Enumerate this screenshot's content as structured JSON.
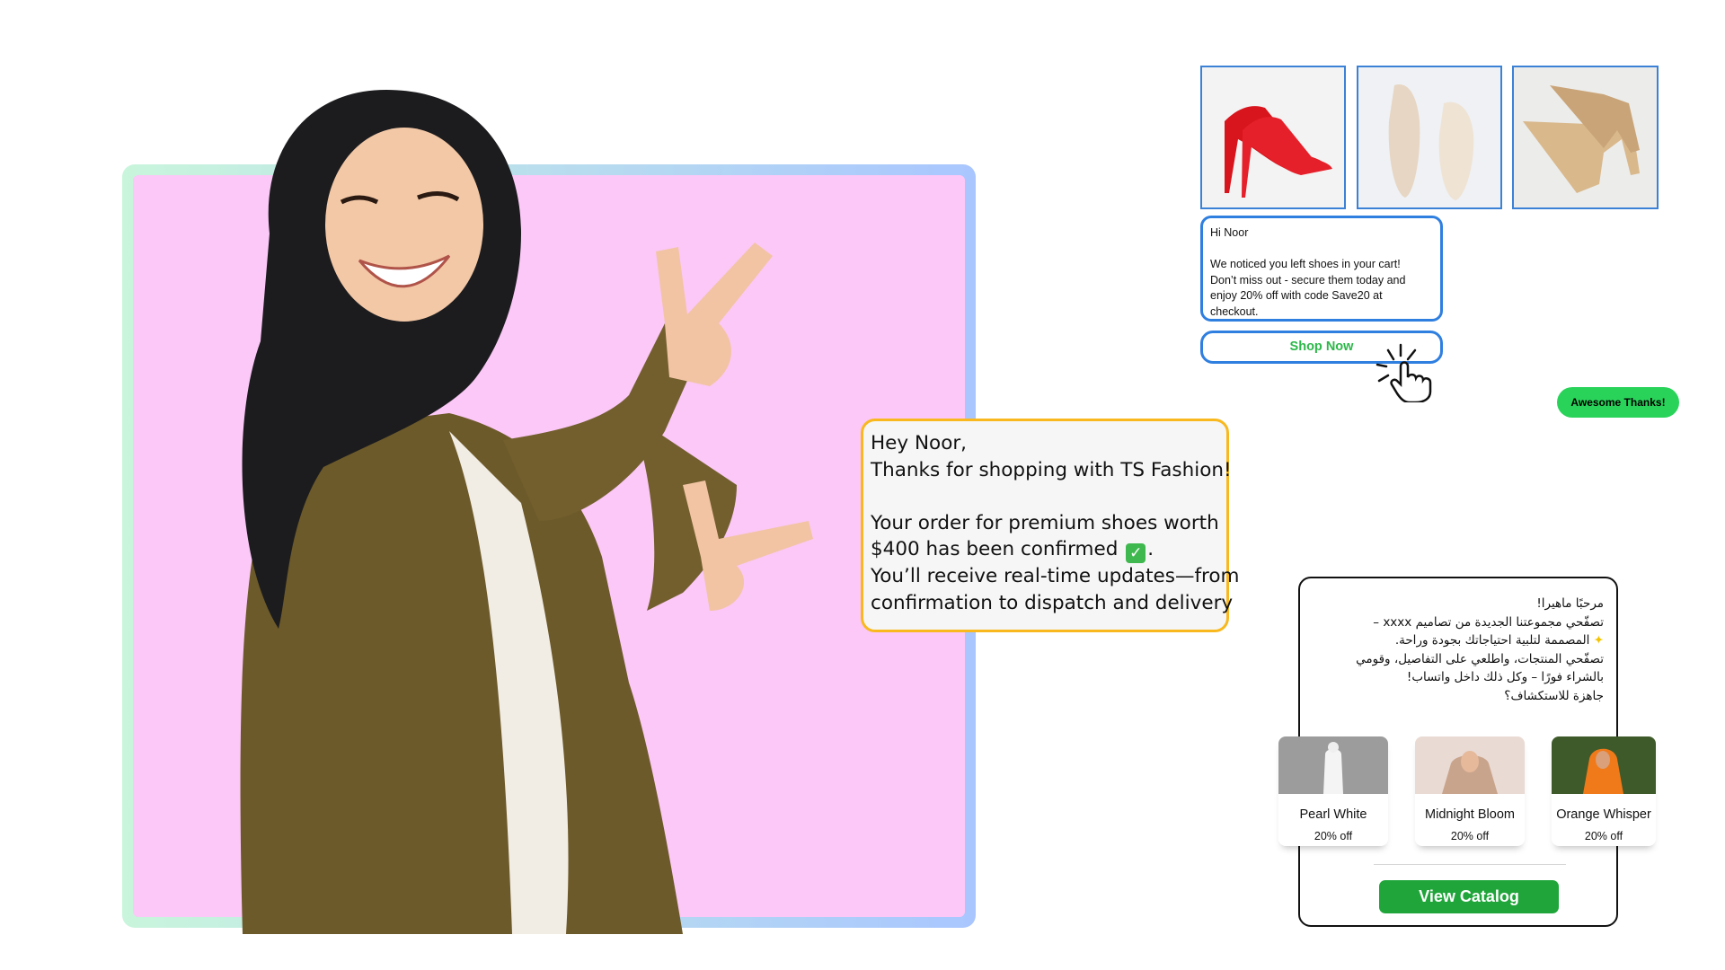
{
  "order_message": {
    "greeting": "Hey Noor,",
    "thanks": "Thanks for shopping with TS Fashion!",
    "line1": "Your order for premium shoes worth",
    "line2_prefix": "$400 has been confirmed",
    "line2_suffix": ".",
    "line3": "You’ll receive real-time updates—from",
    "line4": "confirmation to dispatch and delivery"
  },
  "cart_reminder": {
    "greeting": "Hi Noor",
    "line1": "We noticed you left shoes in your cart!",
    "line2": "Don’t miss out - secure them today and",
    "line3": "enjoy 20% off with code Save20 at",
    "line4": "checkout.",
    "button_label": "Shop Now"
  },
  "reply_pill": {
    "label": "Awesome Thanks!"
  },
  "catalog_message": {
    "line1": "مرحبًا ماهيرا!",
    "line2": "تصفّحي مجموعتنا الجديدة من تصاميم xxxx –",
    "line3": "المصممة لتلبية احتياجاتك بجودة وراحة.",
    "line4": "تصفّحي المنتجات، واطلعي على التفاصيل، وقومي",
    "line5": "بالشراء فورًا – وكل ذلك داخل واتساب!",
    "line6": "جاهزة للاستكشاف؟",
    "products": [
      {
        "name": "Pearl White",
        "discount": "20% off"
      },
      {
        "name": "Midnight Bloom",
        "discount": "20% off"
      },
      {
        "name": "Orange Whisper",
        "discount": "20% off"
      }
    ],
    "button_label": "View Catalog"
  },
  "colors": {
    "hero_background": "#fbc8f7",
    "order_border": "#f8b81e",
    "cart_border": "#2f7fe0",
    "shop_text": "#2db84a",
    "pill": "#29d35a",
    "catalog_button": "#1fa53a"
  }
}
